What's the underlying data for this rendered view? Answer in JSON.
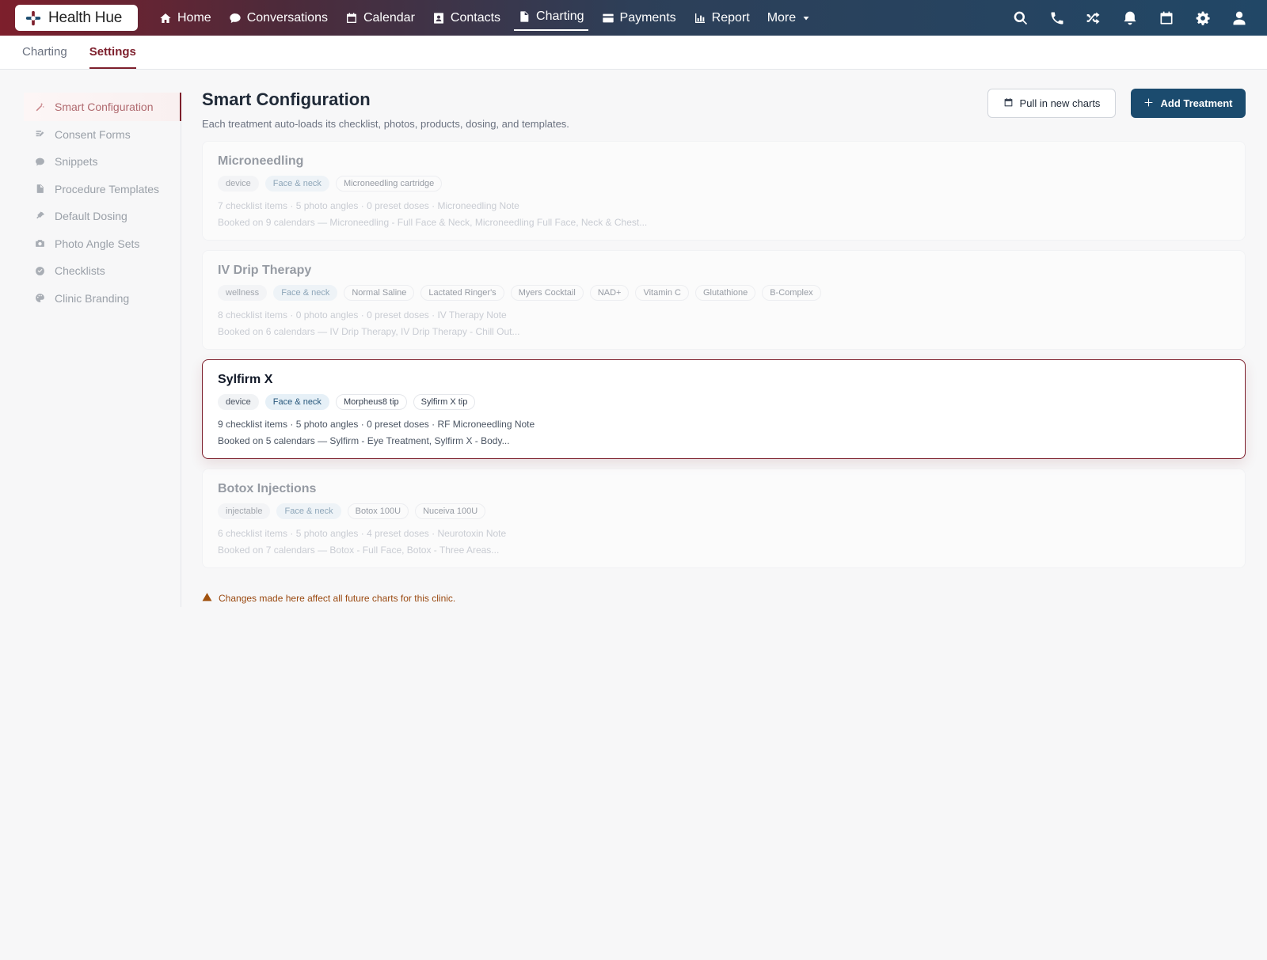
{
  "brand": {
    "name": "Health Hue",
    "colors": {
      "brand": "#7d1f2c",
      "primary": "#1b4b6e",
      "warning": "#a1520f"
    }
  },
  "nav": {
    "items": [
      {
        "label": "Home",
        "icon": "home-icon"
      },
      {
        "label": "Conversations",
        "icon": "chat-icon"
      },
      {
        "label": "Calendar",
        "icon": "calendar-icon"
      },
      {
        "label": "Contacts",
        "icon": "contact-card-icon"
      },
      {
        "label": "Charting",
        "icon": "document-icon",
        "active": true
      },
      {
        "label": "Payments",
        "icon": "credit-card-icon"
      },
      {
        "label": "Report",
        "icon": "bar-chart-icon"
      },
      {
        "label": "More",
        "icon": "caret-down-icon"
      }
    ],
    "right_icons": [
      "search-icon",
      "phone-icon",
      "shuffle-icon",
      "bell-icon",
      "calendar-icon",
      "gear-icon",
      "user-icon"
    ]
  },
  "subtabs": [
    {
      "label": "Charting"
    },
    {
      "label": "Settings",
      "active": true
    }
  ],
  "sidebar": {
    "items": [
      {
        "label": "Smart Configuration",
        "icon": "magic-wand-icon",
        "active": true
      },
      {
        "label": "Consent Forms",
        "icon": "signature-icon"
      },
      {
        "label": "Snippets",
        "icon": "chat-icon"
      },
      {
        "label": "Procedure Templates",
        "icon": "document-icon"
      },
      {
        "label": "Default Dosing",
        "icon": "syringe-icon"
      },
      {
        "label": "Photo Angle Sets",
        "icon": "camera-icon"
      },
      {
        "label": "Checklists",
        "icon": "check-circle-icon"
      },
      {
        "label": "Clinic Branding",
        "icon": "palette-icon"
      }
    ]
  },
  "page": {
    "title": "Smart Configuration",
    "subtitle": "Each treatment auto-loads its checklist, photos, products, dosing, and templates.",
    "pull_button": "Pull in new charts",
    "add_button": "Add Treatment",
    "warning": "Changes made here affect all future charts for this clinic."
  },
  "treatments": [
    {
      "name": "Microneedling",
      "category": "device",
      "area": "Face & neck",
      "products": [
        "Microneedling cartridge"
      ],
      "summary": "7 checklist items · 5 photo angles · 0 preset doses · Microneedling Note",
      "booked": "Booked on 9 calendars — Microneedling - Full Face & Neck, Microneedling Full Face, Neck & Chest...",
      "selected": false
    },
    {
      "name": "IV Drip Therapy",
      "category": "wellness",
      "area": "Face & neck",
      "products": [
        "Normal Saline",
        "Lactated Ringer's",
        "Myers Cocktail",
        "NAD+",
        "Vitamin C",
        "Glutathione",
        "B-Complex"
      ],
      "summary": "8 checklist items · 0 photo angles · 0 preset doses · IV Therapy Note",
      "booked": "Booked on 6 calendars — IV Drip Therapy, IV Drip Therapy - Chill Out...",
      "selected": false
    },
    {
      "name": "Sylfirm X",
      "category": "device",
      "area": "Face & neck",
      "products": [
        "Morpheus8 tip",
        "Sylfirm X tip"
      ],
      "summary": "9 checklist items · 5 photo angles · 0 preset doses · RF Microneedling Note",
      "booked": "Booked on 5 calendars — Sylfirm - Eye Treatment, Sylfirm X - Body...",
      "selected": true
    },
    {
      "name": "Botox Injections",
      "category": "injectable",
      "area": "Face & neck",
      "products": [
        "Botox 100U",
        "Nuceiva 100U"
      ],
      "summary": "6 checklist items · 5 photo angles · 4 preset doses · Neurotoxin Note",
      "booked": "Booked on 7 calendars — Botox - Full Face, Botox - Three Areas...",
      "selected": false
    }
  ]
}
